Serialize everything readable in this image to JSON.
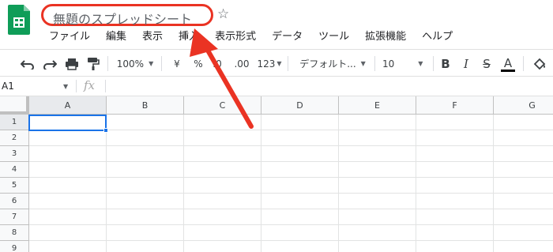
{
  "app": {
    "title": "無題のスプレッドシート",
    "logo_icon": "google-sheets-icon",
    "star_icon": "star-outline-icon",
    "accent_color": "#1a73e8",
    "annotation_color": "#ea3323"
  },
  "menu": [
    "ファイル",
    "編集",
    "表示",
    "挿入",
    "表示形式",
    "データ",
    "ツール",
    "拡張機能",
    "ヘルプ"
  ],
  "toolbar": {
    "undo_icon": "undo-icon",
    "redo_icon": "redo-icon",
    "print_icon": "print-icon",
    "paint_format_icon": "paint-format-icon",
    "zoom": "100%",
    "currency": "¥",
    "percent": "%",
    "decrease_decimal": ".0",
    "increase_decimal": ".00",
    "more_formats": "123",
    "font": "デフォルト...",
    "font_size": "10",
    "bold": "B",
    "italic": "I",
    "strikethrough": "S",
    "text_color": "A",
    "fill_icon": "fill-color-icon"
  },
  "formula_bar": {
    "cell_ref": "A1",
    "fx": "fx"
  },
  "grid": {
    "columns": [
      "A",
      "B",
      "C",
      "D",
      "E",
      "F",
      "G"
    ],
    "rows": [
      "1",
      "2",
      "3",
      "4",
      "5",
      "6",
      "7",
      "8",
      "9"
    ],
    "selected_cell": "A1"
  }
}
